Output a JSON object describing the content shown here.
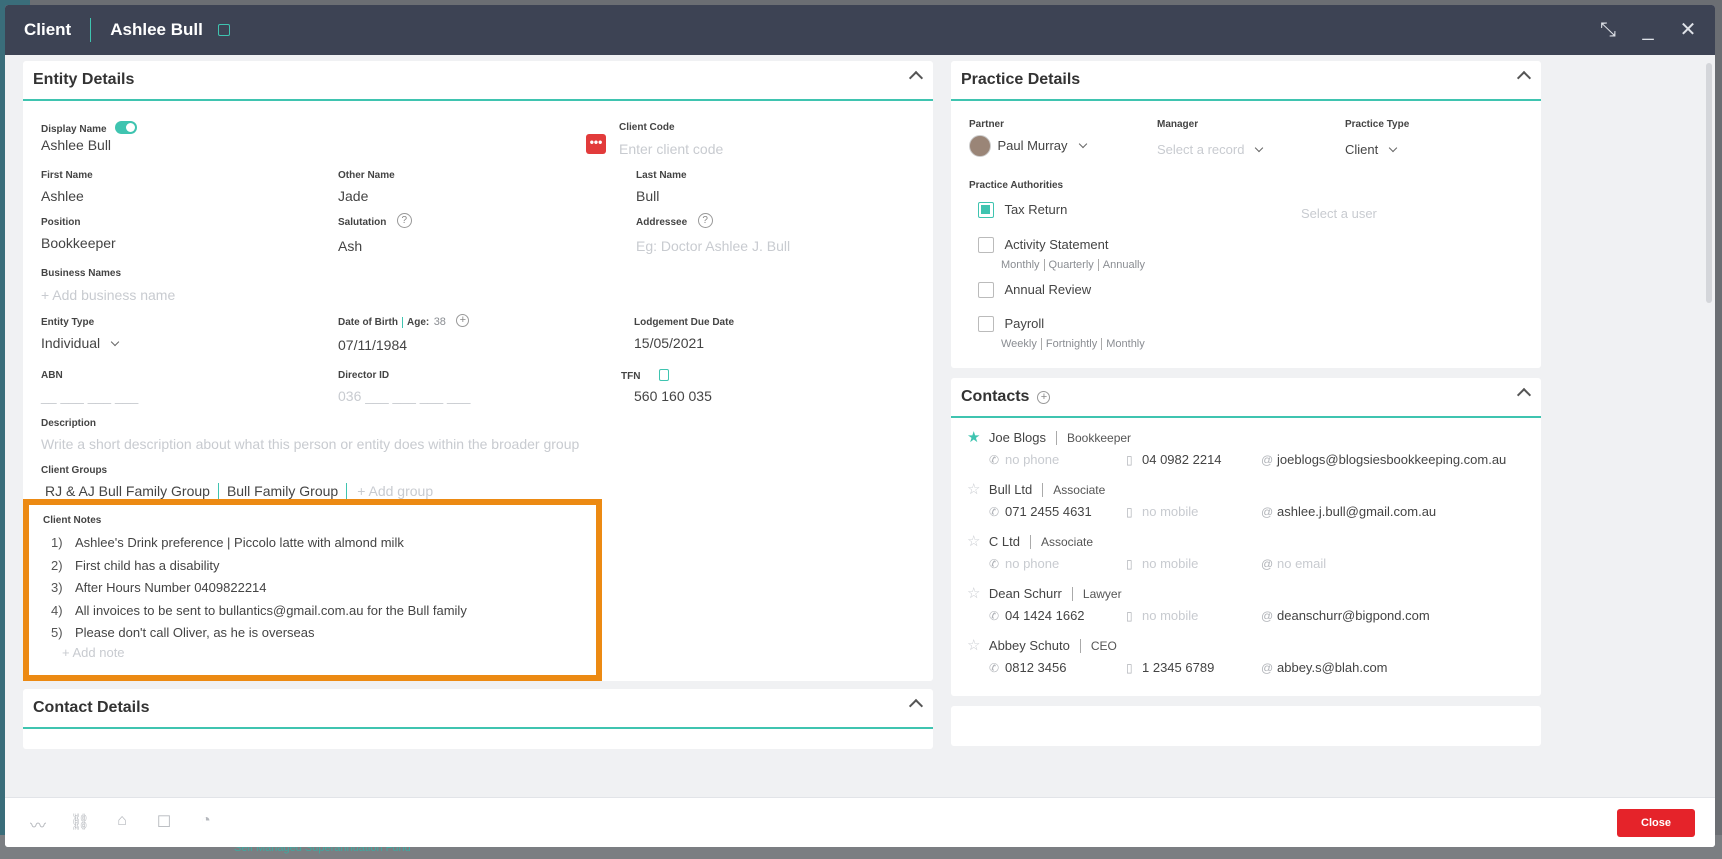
{
  "header": {
    "title": "Client",
    "client_name": "Ashlee Bull"
  },
  "background": {
    "bottom_link": "Self Managed Superannuation Fund"
  },
  "entity": {
    "title": "Entity Details",
    "display_name_label": "Display Name",
    "display_name": "Ashlee Bull",
    "client_code_label": "Client Code",
    "client_code_placeholder": "Enter client code",
    "first_name_label": "First Name",
    "first_name": "Ashlee",
    "other_name_label": "Other Name",
    "other_name": "Jade",
    "last_name_label": "Last Name",
    "last_name": "Bull",
    "position_label": "Position",
    "position": "Bookkeeper",
    "salutation_label": "Salutation",
    "salutation": "Ash",
    "addressee_label": "Addressee",
    "addressee_placeholder": "Eg: Doctor Ashlee J. Bull",
    "business_names_label": "Business Names",
    "add_business": "+ Add business name",
    "entity_type_label": "Entity Type",
    "entity_type": "Individual",
    "dob_label": "Date of Birth",
    "age_label": "Age:",
    "age": "38",
    "dob": "07/11/1984",
    "lodgement_label": "Lodgement Due Date",
    "lodgement": "15/05/2021",
    "abn_label": "ABN",
    "abn_placeholder": "__ ___ ___ ___",
    "director_label": "Director ID",
    "director_placeholder": "036 ___ ___ ___ ___",
    "tfn_label": "TFN",
    "tfn": "560 160 035",
    "description_label": "Description",
    "description_placeholder": "Write a short description about what this person or entity does within the broader group",
    "groups_label": "Client Groups",
    "groups": [
      "RJ & AJ Bull Family Group",
      "Bull Family Group"
    ],
    "add_group": "+ Add group",
    "notes_label": "Client Notes",
    "notes": [
      {
        "n": "1)",
        "text": "Ashlee's Drink preference | Piccolo latte with almond milk"
      },
      {
        "n": "2)",
        "text": "First child has a disability"
      },
      {
        "n": "3)",
        "text": "After Hours Number 0409822214"
      },
      {
        "n": "4)",
        "text": "All invoices to be sent to bullantics@gmail.com.au for the Bull family"
      },
      {
        "n": "5)",
        "text": "Please don't call Oliver, as he is overseas"
      }
    ],
    "add_note": "+ Add note"
  },
  "contact_details": {
    "title": "Contact Details"
  },
  "practice": {
    "title": "Practice Details",
    "partner_label": "Partner",
    "partner": "Paul Murray",
    "manager_label": "Manager",
    "manager_placeholder": "Select a record",
    "type_label": "Practice Type",
    "type": "Client",
    "authorities_label": "Practice Authorities",
    "select_user": "Select a user",
    "authorities": [
      {
        "label": "Tax Return",
        "checked": true,
        "freq": []
      },
      {
        "label": "Activity Statement",
        "checked": false,
        "freq": [
          "Monthly",
          "Quarterly",
          "Annually"
        ]
      },
      {
        "label": "Annual Review",
        "checked": false,
        "freq": []
      },
      {
        "label": "Payroll",
        "checked": false,
        "freq": [
          "Weekly",
          "Fortnightly",
          "Monthly"
        ]
      }
    ]
  },
  "contacts": {
    "title": "Contacts",
    "items": [
      {
        "name": "Joe Blogs",
        "role": "Bookkeeper",
        "star": true,
        "phone": "no phone",
        "mobile": "04 0982 2214",
        "email": "joeblogs@blogsiesbookkeeping.com.au"
      },
      {
        "name": "Bull Ltd",
        "role": "Associate",
        "star": false,
        "phone": "071 2455 4631",
        "mobile": "no mobile",
        "email": "ashlee.j.bull@gmail.com.au"
      },
      {
        "name": "C Ltd",
        "role": "Associate",
        "star": false,
        "phone": "no phone",
        "mobile": "no mobile",
        "email": "no email"
      },
      {
        "name": "Dean Schurr",
        "role": "Lawyer",
        "star": false,
        "phone": "04 1424 1662",
        "mobile": "no mobile",
        "email": "deanschurr@bigpond.com"
      },
      {
        "name": "Abbey Schuto",
        "role": "CEO",
        "star": false,
        "phone": "0812 3456",
        "mobile": "1 2345 6789",
        "email": "abbey.s@blah.com"
      }
    ]
  },
  "footer": {
    "close_label": "Close"
  }
}
